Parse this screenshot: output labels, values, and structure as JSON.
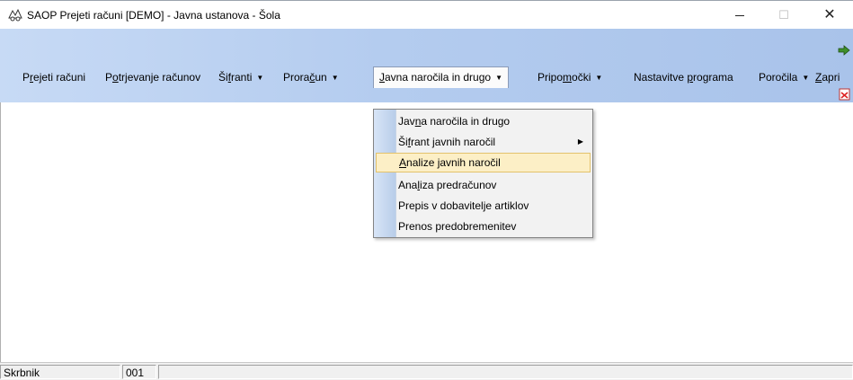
{
  "window": {
    "title": "SAOP Prejeti računi [DEMO] - Javna ustanova - Šola",
    "close_glyph": "✕",
    "maximize_glyph": "☐"
  },
  "menu": {
    "items": [
      {
        "pre": "P",
        "u": "r",
        "post": "ejeti računi",
        "arrow": ""
      },
      {
        "pre": "P",
        "u": "o",
        "post": "trjevanje računov",
        "arrow": ""
      },
      {
        "pre": "Ši",
        "u": "f",
        "post": "ranti",
        "arrow": "▼"
      },
      {
        "pre": "Prora",
        "u": "č",
        "post": "un",
        "arrow": "▼"
      },
      {
        "pre": "",
        "u": "J",
        "post": "avna naročila in drugo",
        "arrow": "▼"
      },
      {
        "pre": "Pripo",
        "u": "m",
        "post": "očki",
        "arrow": "▼"
      },
      {
        "pre": "Nastavitve ",
        "u": "p",
        "post": "rograma",
        "arrow": ""
      },
      {
        "pre": "Poročila",
        "u": "",
        "post": "",
        "arrow": "▼"
      },
      {
        "pre": "",
        "u": "Z",
        "post": "apri",
        "arrow": ""
      }
    ]
  },
  "dropdown": {
    "items": [
      {
        "pre": "Jav",
        "u": "n",
        "post": "a naročila in drugo",
        "submenu": ""
      },
      {
        "pre": "Ši",
        "u": "f",
        "post": "rant javnih naročil",
        "submenu": "▶"
      },
      {
        "pre": "",
        "u": "A",
        "post": "nalize javnih naročil",
        "submenu": ""
      },
      {
        "pre": "Ana",
        "u": "l",
        "post": "iza predračunov",
        "submenu": ""
      },
      {
        "pre": "Prepis v dobavitelje artiklov",
        "u": "",
        "post": "",
        "submenu": ""
      },
      {
        "pre": "Prenos predobremenitev",
        "u": "",
        "post": "",
        "submenu": ""
      }
    ]
  },
  "statusbar": {
    "user": "Skrbnik",
    "code": "001"
  },
  "colors": {
    "menubar_start": "#c7daf5",
    "menubar_end": "#a9c3ea",
    "hover_bg": "#fcefc6",
    "hover_border": "#e3c26b"
  }
}
